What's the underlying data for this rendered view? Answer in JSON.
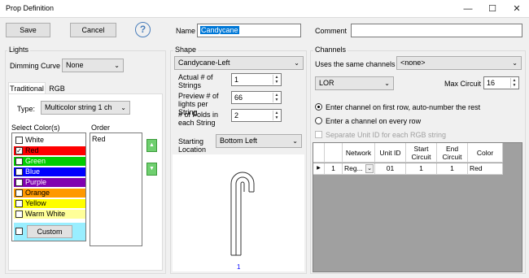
{
  "window": {
    "title": "Prop Definition",
    "minimize": "—",
    "maximize": "☐",
    "close": "✕"
  },
  "toolbar": {
    "save_label": "Save",
    "cancel_label": "Cancel",
    "help_label": "?"
  },
  "header": {
    "name_label": "Name",
    "name_value": "Candycane",
    "comment_label": "Comment",
    "comment_value": ""
  },
  "lights": {
    "group_label": "Lights",
    "dimming_label": "Dimming Curve",
    "dimming_value": "None",
    "tabs": [
      {
        "label": "Traditional"
      },
      {
        "label": "RGB"
      }
    ],
    "type_label": "Type:",
    "type_value": "Multicolor string 1 ch",
    "select_colors_label": "Select Color(s)",
    "order_label": "Order",
    "colors": [
      {
        "label": "White",
        "checked": false,
        "bg": "#ffffff",
        "fg": "#000000"
      },
      {
        "label": "Red",
        "checked": true,
        "bg": "#ff0000",
        "fg": "#000000",
        "mark": "✓"
      },
      {
        "label": "Green",
        "checked": false,
        "bg": "#00cc00",
        "fg": "#ffffff"
      },
      {
        "label": "Blue",
        "checked": false,
        "bg": "#0000ff",
        "fg": "#ffffff"
      },
      {
        "label": "Purple",
        "checked": false,
        "bg": "#8000b0",
        "fg": "#ffffff"
      },
      {
        "label": "Orange",
        "checked": false,
        "bg": "#ff9900",
        "fg": "#000000"
      },
      {
        "label": "Yellow",
        "checked": false,
        "bg": "#ffff00",
        "fg": "#000000"
      },
      {
        "label": "Warm White",
        "checked": false,
        "bg": "#ffff99",
        "fg": "#000000"
      }
    ],
    "custom_label": "Custom",
    "order_items": [
      "Red"
    ],
    "up_icon": "▲",
    "down_icon": "▼"
  },
  "shape": {
    "group_label": "Shape",
    "shape_value": "Candycane-Left",
    "actual_strings_label": "Actual # of Strings",
    "actual_strings_value": "1",
    "preview_lights_label": "Preview # of lights per String",
    "preview_lights_value": "66",
    "folds_label": "# of Folds in each String",
    "folds_value": "2",
    "start_label": "Starting Location",
    "start_value": "Bottom Left",
    "preview_number": "1"
  },
  "channels": {
    "group_label": "Channels",
    "uses_same_label": "Uses the same channels as",
    "uses_same_value": "<none>",
    "network_type": "LOR",
    "max_circuit_label": "Max Circuit",
    "max_circuit_value": "16",
    "radio_first_row": "Enter channel on first row, auto-number the rest",
    "radio_every_row": "Enter a channel on every row",
    "separate_unit_label": "Separate Unit ID for each RGB string",
    "grid_headers": [
      "",
      "",
      "Network",
      "Unit ID",
      "Start Circuit",
      "End Circuit",
      "Color"
    ],
    "grid_rows": [
      [
        "▶",
        "1",
        "Reg...",
        "01",
        "1",
        "1",
        "Red"
      ]
    ]
  }
}
